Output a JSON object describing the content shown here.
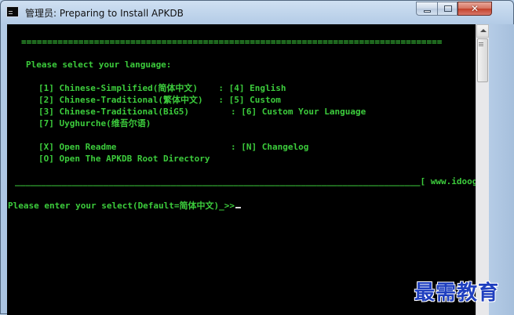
{
  "window": {
    "title": "管理员: Preparing to Install APKDB",
    "controls": {
      "minimize_icon": "minimize-icon",
      "maximize_icon": "maximize-icon",
      "close_label": "✕"
    }
  },
  "console": {
    "separator": "=================================================================================",
    "prompt_header": "Please select your language:",
    "options": [
      "[1] Chinese-Simplified(简体中文)    : [4] English",
      "[2] Chinese-Traditional(繁体中文)   : [5] Custom",
      "[3] Chinese-Traditional(BiG5)        : [6] Custom Your Language",
      "[7] Uyghurche(维吾尔语)"
    ],
    "actions": [
      "[X] Open Readme                      : [N] Changelog",
      "[O] Open The APKDB Root Directory"
    ],
    "footer_rule": "______________________________________________________________________________[ www.idoog.me ]",
    "input_prompt": "Please enter your select(Default=简体中文)_>>"
  },
  "watermark": "最需教育",
  "colors": {
    "console_text": "#3ccc3c",
    "console_bg": "#000000",
    "watermark": "#1f3fbf"
  }
}
